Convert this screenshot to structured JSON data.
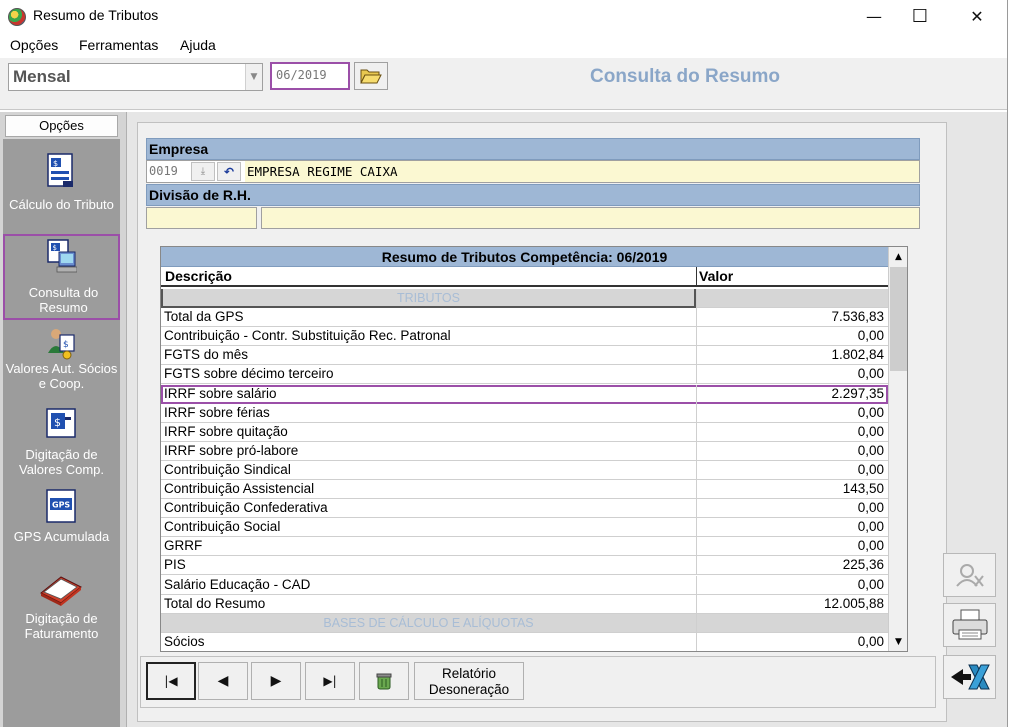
{
  "window": {
    "title": "Resumo de Tributos",
    "controls": {
      "minimize": "—",
      "maximize": "☐",
      "close": "✕"
    }
  },
  "menu": [
    "Opções",
    "Ferramentas",
    "Ajuda"
  ],
  "toolbar": {
    "period_type": "Mensal",
    "competencia": "06/2019",
    "heading": "Consulta do Resumo"
  },
  "sidebar": {
    "header": "Opções",
    "items": [
      {
        "label": "Cálculo do Tributo",
        "icon": "calculator-doc-icon"
      },
      {
        "label": "Consulta do Resumo",
        "icon": "computer-consult-icon"
      },
      {
        "label": "Valores Aut. Sócios e Coop.",
        "icon": "people-money-icon"
      },
      {
        "label": "Digitação de Valores Comp.",
        "icon": "money-entry-icon"
      },
      {
        "label": "GPS Acumulada",
        "icon": "gps-doc-icon"
      },
      {
        "label": "Digitação de Faturamento",
        "icon": "ledger-book-icon"
      }
    ]
  },
  "empresa": {
    "label": "Empresa",
    "code": "0019",
    "name": "EMPRESA REGIME CAIXA",
    "divisao_label": "Divisão de R.H.",
    "divisao_code": "",
    "divisao_name": ""
  },
  "table": {
    "title": "Resumo de Tributos Competência: 06/2019",
    "headers": {
      "descricao": "Descrição",
      "valor": "Valor"
    },
    "rows": [
      {
        "type": "section",
        "descricao": "TRIBUTOS",
        "valor": ""
      },
      {
        "type": "data",
        "descricao": "Total da GPS",
        "valor": "7.536,83"
      },
      {
        "type": "data",
        "descricao": "Contribuição - Contr. Substituição Rec. Patronal",
        "valor": "0,00"
      },
      {
        "type": "data",
        "descricao": "FGTS do mês",
        "valor": "1.802,84"
      },
      {
        "type": "data",
        "descricao": "FGTS sobre décimo terceiro",
        "valor": "0,00"
      },
      {
        "type": "data",
        "descricao": "IRRF sobre salário",
        "valor": "2.297,35",
        "highlight": true
      },
      {
        "type": "data",
        "descricao": "IRRF sobre férias",
        "valor": "0,00"
      },
      {
        "type": "data",
        "descricao": "IRRF sobre quitação",
        "valor": "0,00"
      },
      {
        "type": "data",
        "descricao": "IRRF sobre pró-labore",
        "valor": "0,00"
      },
      {
        "type": "data",
        "descricao": "Contribuição Sindical",
        "valor": "0,00"
      },
      {
        "type": "data",
        "descricao": "Contribuição Assistencial",
        "valor": "143,50"
      },
      {
        "type": "data",
        "descricao": "Contribuição Confederativa",
        "valor": "0,00"
      },
      {
        "type": "data",
        "descricao": "Contribuição Social",
        "valor": "0,00"
      },
      {
        "type": "data",
        "descricao": "GRRF",
        "valor": "0,00"
      },
      {
        "type": "data",
        "descricao": "PIS",
        "valor": "225,36"
      },
      {
        "type": "data",
        "descricao": "Salário Educação - CAD",
        "valor": "0,00"
      },
      {
        "type": "data",
        "descricao": "Total do Resumo",
        "valor": "12.005,88"
      },
      {
        "type": "section",
        "descricao": "BASES DE CÁLCULO E ALÍQUOTAS",
        "valor": ""
      },
      {
        "type": "data",
        "descricao": "Sócios",
        "valor": "0,00"
      }
    ]
  },
  "nav": {
    "first": "|◀",
    "prev": "◀",
    "next": "▶",
    "last": "▶|",
    "report_label": "Relatório Desoneração"
  },
  "colors": {
    "highlight": "#9b4fa8",
    "section_bar": "#9eb7d5",
    "heading": "#8aa6c8",
    "field_yellow": "#fbf8d2"
  }
}
